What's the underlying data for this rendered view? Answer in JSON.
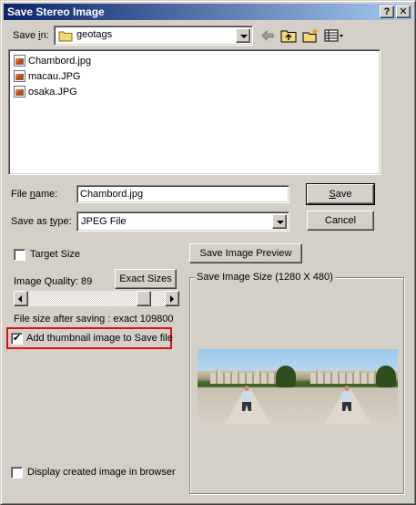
{
  "window": {
    "title": "Save Stereo Image",
    "help_glyph": "?",
    "close_glyph": "✕"
  },
  "save_in": {
    "label": "Save ",
    "label_u": "i",
    "label_after": "n:",
    "folder": "geotags"
  },
  "toolbar_icons": [
    "back-arrow-icon",
    "up-folder-icon",
    "new-folder-icon",
    "view-menu-icon"
  ],
  "files": [
    {
      "name": "Chambord.jpg"
    },
    {
      "name": "macau.JPG"
    },
    {
      "name": "osaka.JPG"
    }
  ],
  "filename": {
    "label": "File ",
    "label_u": "n",
    "label_after": "ame:",
    "value": "Chambord.jpg"
  },
  "save_as_type": {
    "label": "Save as ",
    "label_u": "t",
    "label_after": "ype:",
    "value": "JPEG File"
  },
  "buttons": {
    "save": "Save",
    "save_u": "S",
    "save_after": "ave",
    "cancel": "Cancel",
    "save_preview": "Save Image Preview",
    "exact_sizes": "Exact Sizes"
  },
  "options": {
    "target_size": {
      "label": "Target Size",
      "checked": false
    },
    "image_quality_label": "Image Quality:",
    "image_quality_value": "89",
    "quality_fraction": 0.89,
    "file_size_text": "File size after saving : exact 109800",
    "add_thumbnail": {
      "label": "Add thumbnail image to Save file",
      "checked": true
    },
    "display_in_browser": {
      "label": "Display created image in browser",
      "checked": false
    }
  },
  "preview": {
    "group_label": "Save Image Size (1280 X 480)"
  },
  "colors": {
    "highlight": "#e01010",
    "titlebar_start": "#0a246a",
    "titlebar_end": "#a6caf0",
    "face": "#d4d0c8"
  }
}
